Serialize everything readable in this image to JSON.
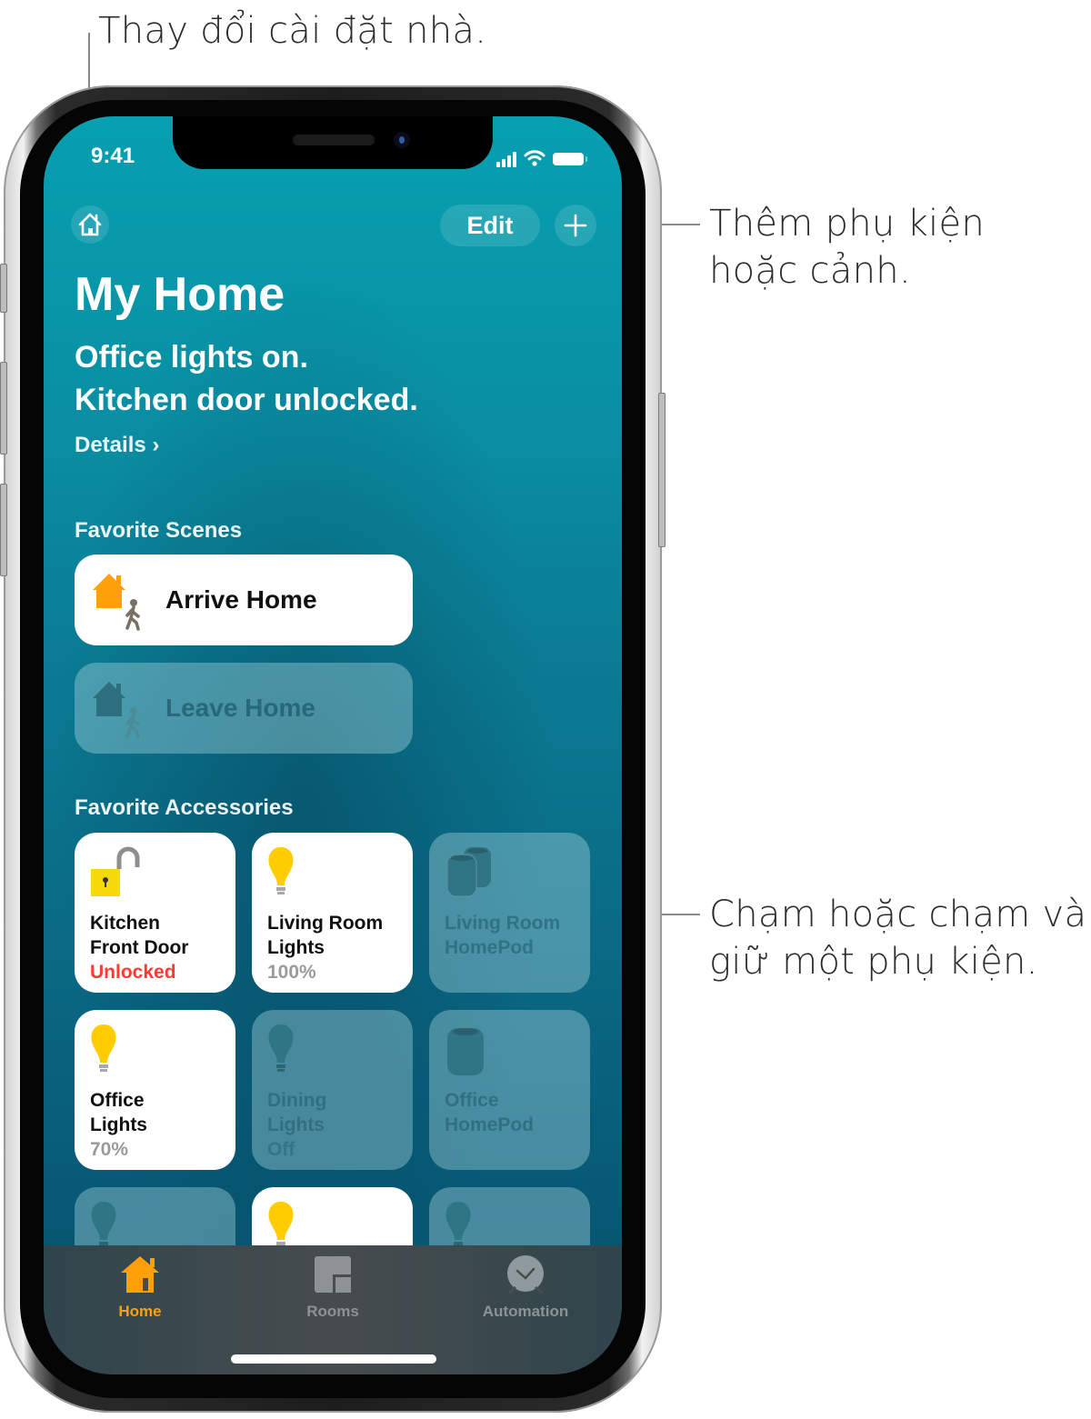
{
  "callouts": {
    "home_settings": "Thay đổi cài đặt nhà.",
    "add": [
      "Thêm phụ kiện",
      "hoặc cảnh."
    ],
    "accessory": [
      "Chạm hoặc chạm và",
      "giữ một phụ kiện."
    ]
  },
  "status_bar": {
    "time": "9:41",
    "icons": [
      "cellular-signal-icon",
      "wifi-icon",
      "battery-icon"
    ]
  },
  "toolbar": {
    "home_icon": "house-icon",
    "edit_label": "Edit",
    "add_icon": "plus-icon"
  },
  "header": {
    "title": "My Home",
    "status_lines": [
      "Office lights on.",
      "Kitchen door unlocked."
    ],
    "details_link": "Details ›"
  },
  "favorite_scenes": {
    "label": "Favorite Scenes",
    "items": [
      {
        "name": "Arrive Home",
        "icon": "arrive-home-icon",
        "active": true
      },
      {
        "name": "Leave Home",
        "icon": "leave-home-icon",
        "active": false
      }
    ]
  },
  "favorite_accessories": {
    "label": "Favorite Accessories",
    "items": [
      {
        "name": "Kitchen\nFront Door",
        "status": "Unlocked",
        "icon": "unlocked-padlock-icon",
        "active": true,
        "alert": true
      },
      {
        "name": "Living Room\nLights",
        "status": "100%",
        "icon": "lightbulb-icon",
        "active": true,
        "alert": false
      },
      {
        "name": "Living Room\nHomePod",
        "status": "",
        "icon": "homepod-pair-icon",
        "active": false,
        "alert": false
      },
      {
        "name": "Office\nLights",
        "status": "70%",
        "icon": "lightbulb-icon",
        "active": true,
        "alert": false
      },
      {
        "name": "Dining\nLights",
        "status": "Off",
        "icon": "lightbulb-icon",
        "active": false,
        "alert": false
      },
      {
        "name": "Office\nHomePod",
        "status": "",
        "icon": "homepod-icon",
        "active": false,
        "alert": false
      },
      {
        "name": "",
        "status": "",
        "icon": "lightbulb-icon",
        "active": false,
        "alert": false
      },
      {
        "name": "",
        "status": "",
        "icon": "lightbulb-icon",
        "active": true,
        "alert": false
      },
      {
        "name": "",
        "status": "",
        "icon": "lightbulb-icon",
        "active": false,
        "alert": false
      }
    ]
  },
  "tab_bar": {
    "tabs": [
      {
        "label": "Home",
        "icon": "home-tab-icon",
        "selected": true
      },
      {
        "label": "Rooms",
        "icon": "rooms-tab-icon",
        "selected": false
      },
      {
        "label": "Automation",
        "icon": "automation-tab-icon",
        "selected": false
      }
    ]
  },
  "colors": {
    "accent_orange": "#ff9f0a",
    "bulb_yellow": "#ffcc00",
    "lock_yellow": "#f5d90a",
    "alert_red": "#ff3b30",
    "screen_teal": "#0a8ea3"
  }
}
